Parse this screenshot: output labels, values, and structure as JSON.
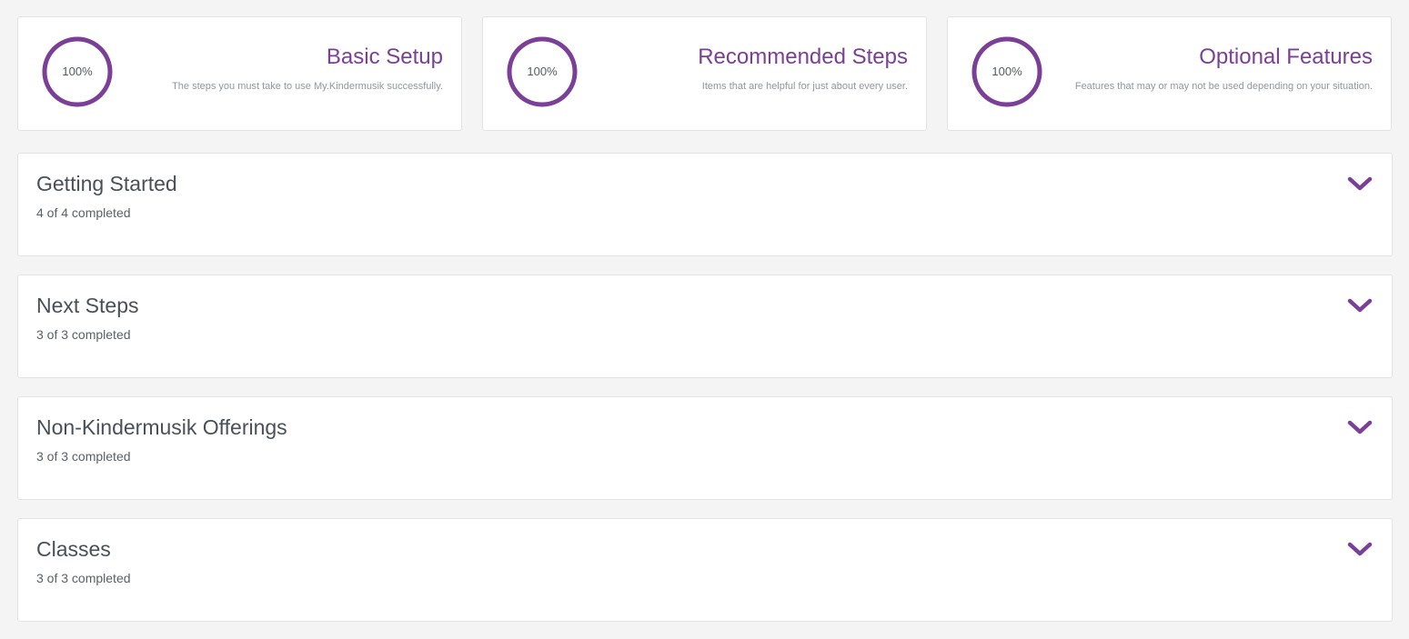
{
  "theme": {
    "accent": "#7b3f98",
    "background": "#f4f4f4",
    "card": "#ffffff"
  },
  "summary_cards": [
    {
      "percent_label": "100%",
      "progress": 1.0,
      "title": "Basic Setup",
      "description": "The steps you must take to use My.Kindermusik successfully."
    },
    {
      "percent_label": "100%",
      "progress": 1.0,
      "title": "Recommended Steps",
      "description": "Items that are helpful for just about every user."
    },
    {
      "percent_label": "100%",
      "progress": 1.0,
      "title": "Optional Features",
      "description": "Features that may or may not be used depending on your situation."
    }
  ],
  "sections": [
    {
      "title": "Getting Started",
      "progress_text": "4 of 4 completed",
      "icon": "chevron-down-icon"
    },
    {
      "title": "Next Steps",
      "progress_text": "3 of 3 completed",
      "icon": "chevron-down-icon"
    },
    {
      "title": "Non-Kindermusik Offerings",
      "progress_text": "3 of 3 completed",
      "icon": "chevron-down-icon"
    },
    {
      "title": "Classes",
      "progress_text": "3 of 3 completed",
      "icon": "chevron-down-icon"
    }
  ]
}
